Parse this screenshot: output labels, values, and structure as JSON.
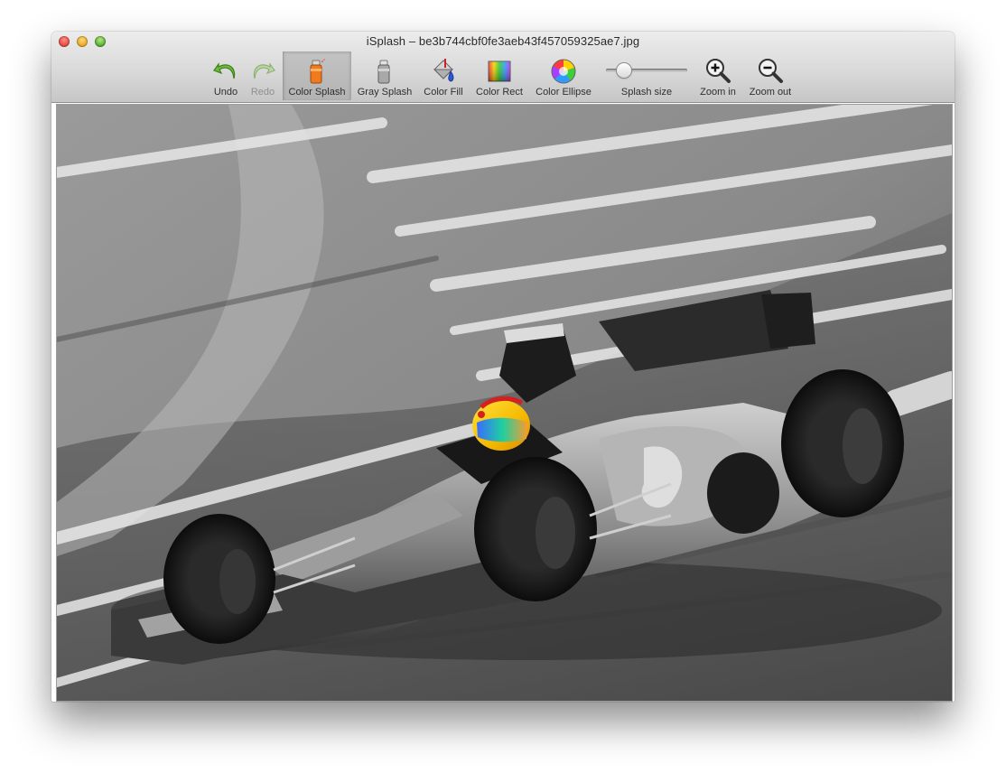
{
  "window": {
    "title": "iSplash – be3b744cbf0fe3aeb43f457059325ae7.jpg"
  },
  "toolbar": {
    "undo": "Undo",
    "redo": "Redo",
    "color_splash": "Color Splash",
    "gray_splash": "Gray Splash",
    "color_fill": "Color Fill",
    "color_rect": "Color Rect",
    "color_ellipse": "Color Ellipse",
    "splash_size": "Splash size",
    "zoom_in": "Zoom in",
    "zoom_out": "Zoom out",
    "selected_tool": "Color Splash",
    "disabled_tools": [
      "Redo"
    ],
    "splash_size_level": 0.25
  },
  "canvas": {
    "image": "grayscale race car photo with color-splashed driver helmet"
  },
  "colors": {
    "accent_undo": "#5ea82f",
    "selected_tool_bg": "#bcbcbc"
  }
}
